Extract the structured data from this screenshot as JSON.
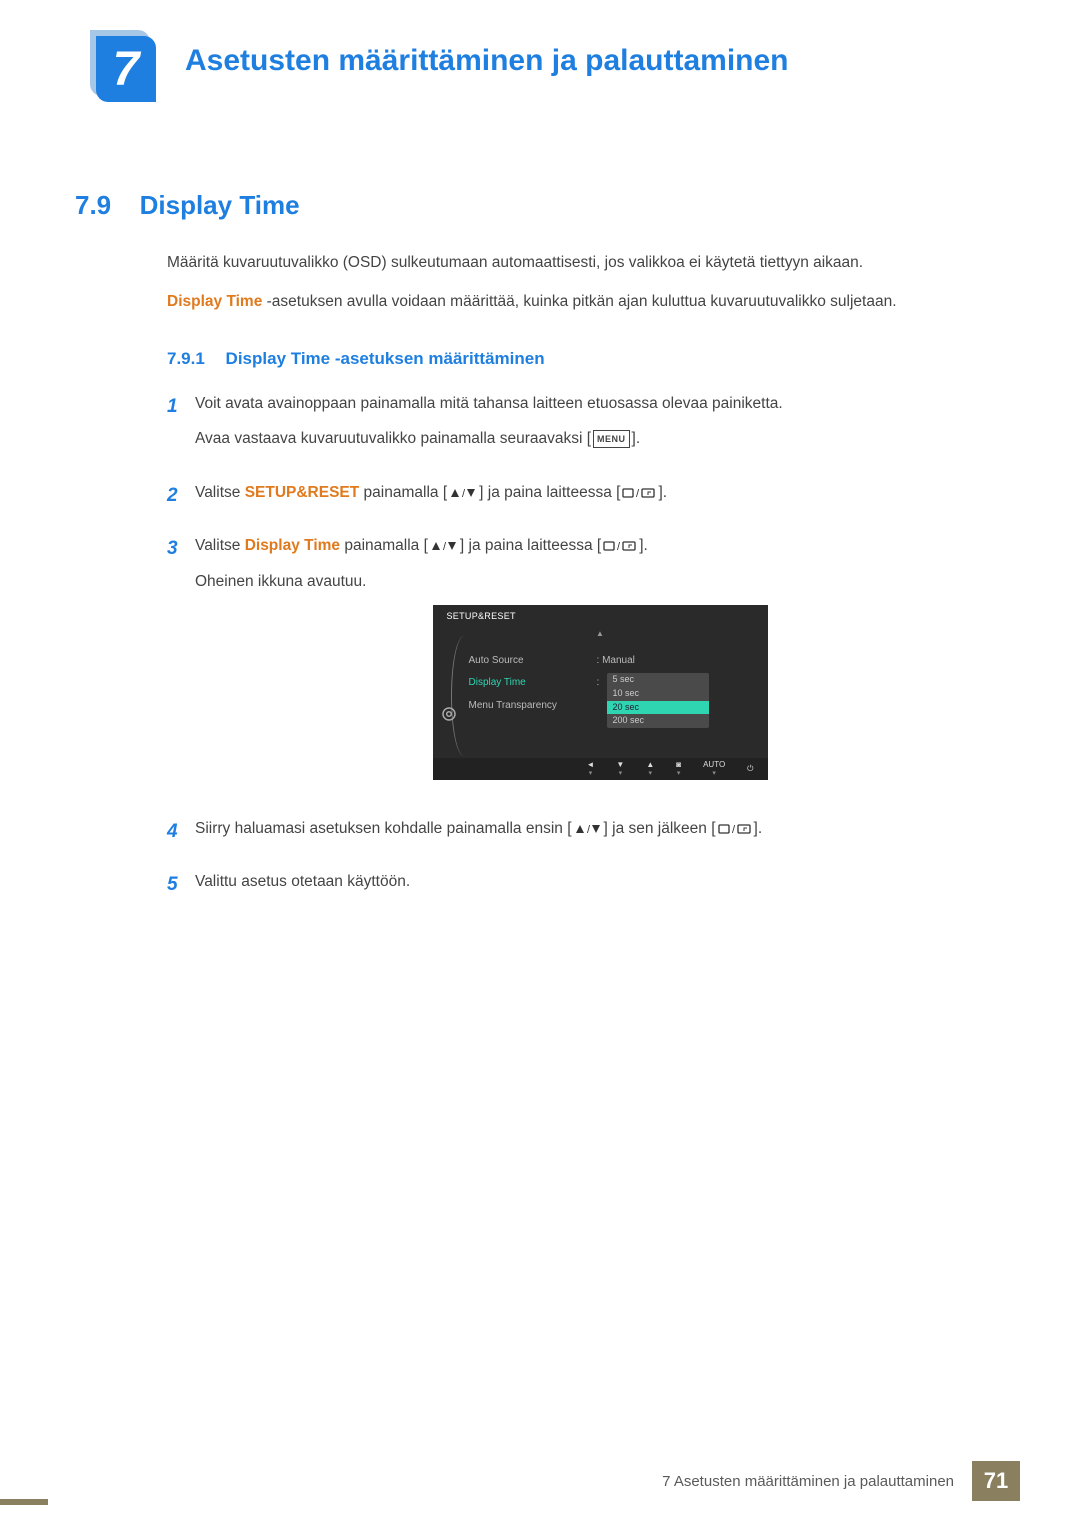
{
  "chapter": {
    "number": "7",
    "title": "Asetusten määrittäminen ja palauttaminen"
  },
  "section": {
    "number": "7.9",
    "title": "Display Time"
  },
  "paragraphs": {
    "p1": "Määritä kuvaruutuvalikko (OSD) sulkeutumaan automaattisesti, jos valikkoa ei käytetä tiettyyn aikaan.",
    "p2_term": "Display Time",
    "p2_rest": " -asetuksen avulla voidaan määrittää, kuinka pitkän ajan kuluttua kuvaruutuvalikko suljetaan."
  },
  "subsection": {
    "number": "7.9.1",
    "title": "Display Time -asetuksen määrittäminen"
  },
  "steps": {
    "s1": {
      "num": "1",
      "a": "Voit avata avainoppaan painamalla mitä tahansa laitteen etuosassa olevaa painiketta.",
      "b_pre": "Avaa vastaava kuvaruutuvalikko painamalla seuraavaksi [",
      "b_icon": "MENU",
      "b_post": "]."
    },
    "s2": {
      "num": "2",
      "pre": "Valitse ",
      "kw": "SETUP&RESET",
      "mid1": " painamalla [",
      "mid2": "] ja paina laitteessa [",
      "end": "]."
    },
    "s3": {
      "num": "3",
      "pre": "Valitse ",
      "kw": "Display Time",
      "mid1": " painamalla [",
      "mid2": "] ja paina laitteessa [",
      "end": "].",
      "extra": "Oheinen ikkuna avautuu."
    },
    "s4": {
      "num": "4",
      "pre": "Siirry haluamasi asetuksen kohdalle painamalla ensin [",
      "mid": "] ja sen jälkeen [",
      "end": "]."
    },
    "s5": {
      "num": "5",
      "txt": "Valittu asetus otetaan käyttöön."
    }
  },
  "osd": {
    "title": "SETUP&RESET",
    "items": {
      "auto_source": "Auto Source",
      "display_time": "Display Time",
      "menu_transparency": "Menu Transparency"
    },
    "values": {
      "auto_source": "Manual"
    },
    "dropdown": [
      "5 sec",
      "10 sec",
      "20 sec",
      "200 sec"
    ],
    "dropdown_selected_index": 2,
    "bottombar": {
      "auto": "AUTO"
    }
  },
  "footer": {
    "text": "7 Asetusten määrittäminen ja palauttaminen",
    "page": "71"
  }
}
